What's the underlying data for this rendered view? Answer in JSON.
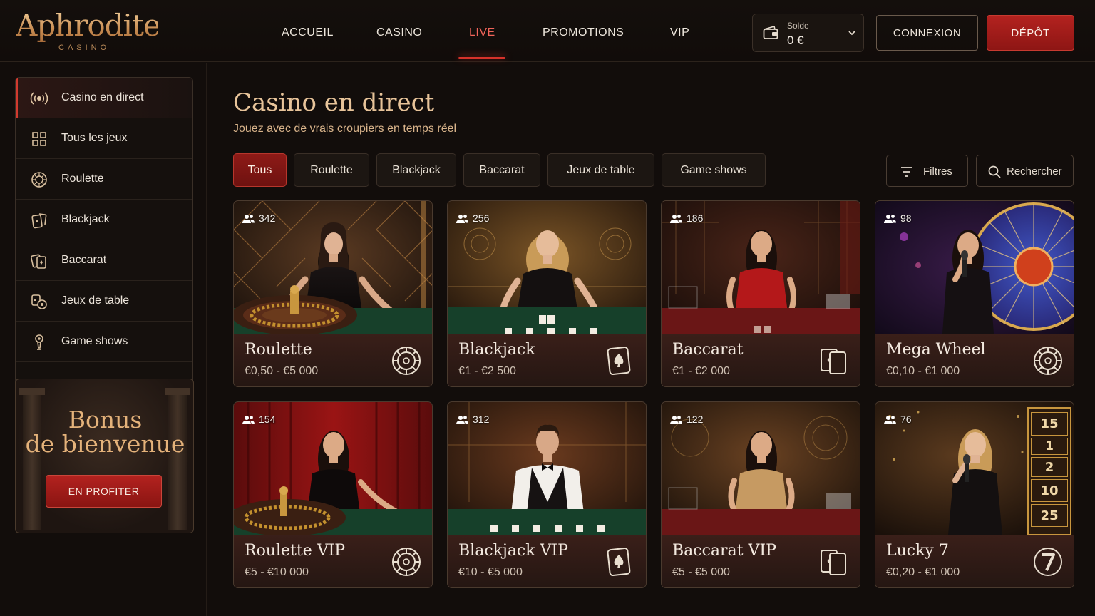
{
  "brand": {
    "name": "Aphrodite",
    "tagline": "CASINO"
  },
  "nav": [
    {
      "label": "ACCUEIL",
      "active": false
    },
    {
      "label": "CASINO",
      "active": false
    },
    {
      "label": "LIVE",
      "active": true
    },
    {
      "label": "PROMOTIONS",
      "active": false
    },
    {
      "label": "VIP",
      "active": false
    }
  ],
  "wallet": {
    "label": "Solde",
    "value": "0 €"
  },
  "auth": {
    "login": "CONNEXION",
    "deposit": "DÉPÔT"
  },
  "sidebar": {
    "items": [
      {
        "label": "Casino en direct",
        "icon": "broadcast-icon",
        "active": true
      },
      {
        "label": "Tous les jeux",
        "icon": "grid-icon",
        "active": false
      },
      {
        "label": "Roulette",
        "icon": "roulette-icon",
        "active": false
      },
      {
        "label": "Blackjack",
        "icon": "cards-icon",
        "active": false
      },
      {
        "label": "Baccarat",
        "icon": "baccarat-icon",
        "active": false
      },
      {
        "label": "Jeux de table",
        "icon": "table-games-icon",
        "active": false
      },
      {
        "label": "Game shows",
        "icon": "microphone-icon",
        "active": false
      }
    ],
    "bonus": {
      "title_line1": "Bonus",
      "title_line2": "de bienvenue",
      "button": "EN PROFITER"
    }
  },
  "main": {
    "title": "Casino en direct",
    "subtitle": "Jouez avec de vrais croupiers en temps réel",
    "filters": [
      {
        "label": "Tous",
        "active": true
      },
      {
        "label": "Roulette",
        "active": false
      },
      {
        "label": "Blackjack",
        "active": false
      },
      {
        "label": "Baccarat",
        "active": false
      },
      {
        "label": "Jeux de table",
        "active": false
      },
      {
        "label": "Game shows",
        "active": false
      }
    ],
    "tools": {
      "filters": "Filtres",
      "search": "Rechercher"
    },
    "games": [
      {
        "name": "Roulette",
        "limits": "€0,50 - €5 000",
        "players": "342",
        "icon": "roulette-wheel-icon"
      },
      {
        "name": "Blackjack",
        "limits": "€1 - €2 500",
        "players": "256",
        "icon": "spade-card-icon"
      },
      {
        "name": "Baccarat",
        "limits": "€1 - €2 000",
        "players": "186",
        "icon": "two-cards-icon"
      },
      {
        "name": "Mega Wheel",
        "limits": "€0,10 - €1 000",
        "players": "98",
        "icon": "roulette-wheel-icon"
      },
      {
        "name": "Roulette VIP",
        "limits": "€5 - €10 000",
        "players": "154",
        "icon": "roulette-wheel-icon"
      },
      {
        "name": "Blackjack VIP",
        "limits": "€10 - €5 000",
        "players": "312",
        "icon": "spade-card-icon"
      },
      {
        "name": "Baccarat VIP",
        "limits": "€5 - €5 000",
        "players": "122",
        "icon": "two-cards-icon"
      },
      {
        "name": "Lucky 7",
        "limits": "€0,20 - €1 000",
        "players": "76",
        "icon": "seven-badge-icon"
      }
    ],
    "lucky7_board": [
      "15",
      "1",
      "2",
      "10",
      "25"
    ]
  },
  "colors": {
    "accent": "#d6322a",
    "gold": "#e4b27a",
    "background": "#120d0b"
  }
}
